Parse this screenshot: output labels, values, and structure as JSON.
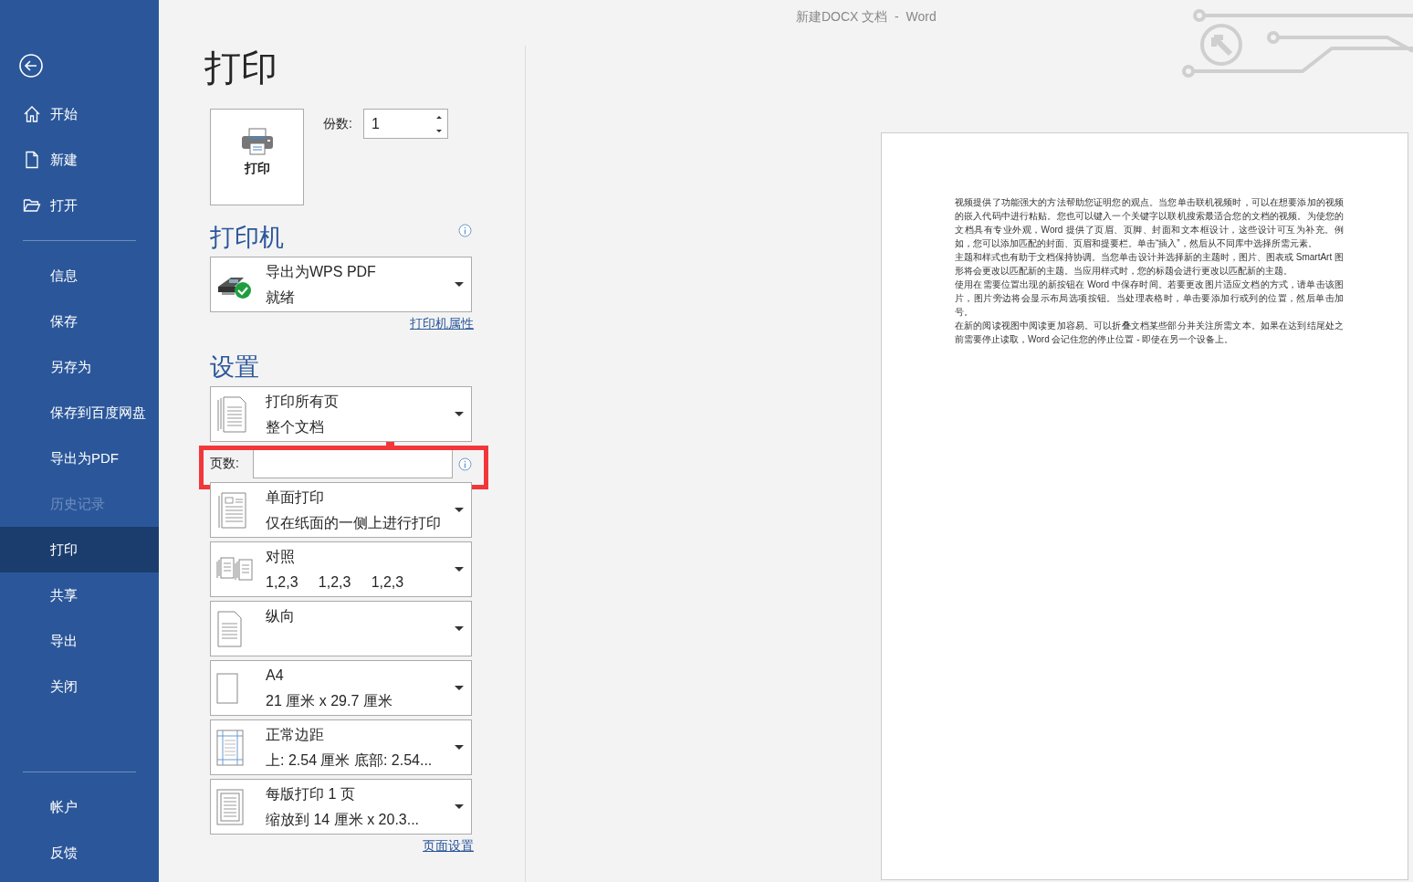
{
  "window": {
    "title": "新建DOCX 文档  -  Word"
  },
  "sidebar": {
    "items": [
      {
        "label": "开始",
        "kind": "home",
        "selected": false,
        "disabled": false
      },
      {
        "label": "新建",
        "kind": "new",
        "selected": false,
        "disabled": false
      },
      {
        "label": "打开",
        "kind": "open",
        "selected": false,
        "disabled": false
      },
      {
        "label": "信息",
        "kind": "plain",
        "selected": false,
        "disabled": false,
        "divider_before": true
      },
      {
        "label": "保存",
        "kind": "plain",
        "selected": false,
        "disabled": false
      },
      {
        "label": "另存为",
        "kind": "plain",
        "selected": false,
        "disabled": false
      },
      {
        "label": "保存到百度网盘",
        "kind": "plain",
        "selected": false,
        "disabled": false
      },
      {
        "label": "导出为PDF",
        "kind": "plain",
        "selected": false,
        "disabled": false
      },
      {
        "label": "历史记录",
        "kind": "plain",
        "selected": false,
        "disabled": true
      },
      {
        "label": "打印",
        "kind": "plain",
        "selected": true,
        "disabled": false
      },
      {
        "label": "共享",
        "kind": "plain",
        "selected": false,
        "disabled": false
      },
      {
        "label": "导出",
        "kind": "plain",
        "selected": false,
        "disabled": false
      },
      {
        "label": "关闭",
        "kind": "plain",
        "selected": false,
        "disabled": false
      }
    ],
    "bottom_items": [
      {
        "label": "帐户",
        "selected": false
      },
      {
        "label": "反馈",
        "selected": false
      }
    ]
  },
  "page_title": "打印",
  "print_button": "打印",
  "copies": {
    "label": "份数:",
    "value": "1"
  },
  "printer": {
    "heading": "打印机",
    "name": "导出为WPS PDF",
    "status": "就绪",
    "properties_link": "打印机属性"
  },
  "settings": {
    "heading": "设置",
    "items": [
      {
        "kind": "pages",
        "title": "打印所有页",
        "subtitle": "整个文档"
      },
      {
        "kind": "pages_field",
        "label": "页数:",
        "highlighted": true
      },
      {
        "kind": "sides",
        "title": "单面打印",
        "subtitle": "仅在纸面的一侧上进行打印"
      },
      {
        "kind": "collate",
        "title": "对照",
        "subtitle": "1,2,3     1,2,3     1,2,3"
      },
      {
        "kind": "orientation",
        "title": "纵向"
      },
      {
        "kind": "paper",
        "title": "A4",
        "subtitle": "21 厘米 x 29.7 厘米"
      },
      {
        "kind": "margins",
        "title": "正常边距",
        "subtitle": "上: 2.54 厘米 底部: 2.54..."
      },
      {
        "kind": "per_sheet",
        "title": "每版打印 1 页",
        "subtitle": "缩放到 14 厘米 x 20.3..."
      }
    ],
    "page_setup_link": "页面设置"
  },
  "preview": {
    "paragraphs": [
      "视频提供了功能强大的方法帮助您证明您的观点。当您单击联机视频时，可以在想要添加的视频的嵌入代码中进行粘贴。您也可以键入一个关键字以联机搜索最适合您的文档的视频。为使您的文档具有专业外观，Word 提供了页眉、页脚、封面和文本框设计，这些设计可互为补充。例如，您可以添加匹配的封面、页眉和提要栏。单击“插入”，然后从不同库中选择所需元素。",
      "主题和样式也有助于文档保持协调。当您单击设计并选择新的主题时，图片、图表或 SmartArt 图形将会更改以匹配新的主题。当应用样式时，您的标题会进行更改以匹配新的主题。",
      "使用在需要位置出现的新按钮在 Word 中保存时间。若要更改图片适应文档的方式，请单击该图片，图片旁边将会显示布局选项按钮。当处理表格时，单击要添加行或列的位置，然后单击加号。",
      "在新的阅读视图中阅读更加容易。可以折叠文档某些部分并关注所需文本。如果在达到结尾处之前需要停止读取，Word 会记住您的停止位置 - 即使在另一个设备上。"
    ]
  }
}
